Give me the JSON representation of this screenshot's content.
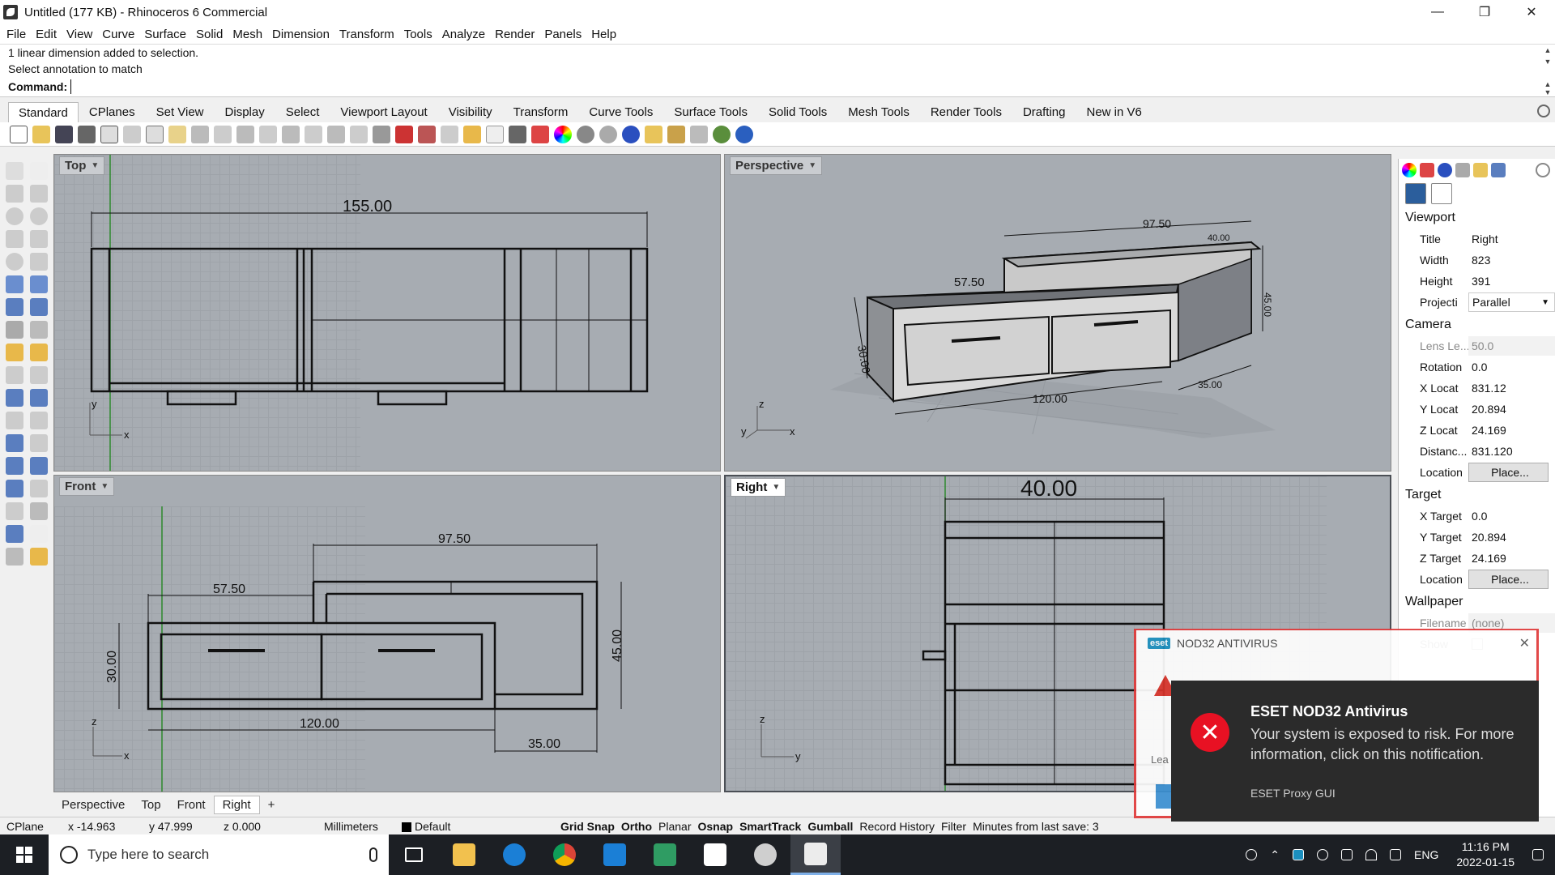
{
  "window": {
    "title": "Untitled (177 KB) - Rhinoceros 6 Commercial",
    "minimize": "—",
    "maximize": "❐",
    "close": "✕"
  },
  "menu": [
    "File",
    "Edit",
    "View",
    "Curve",
    "Surface",
    "Solid",
    "Mesh",
    "Dimension",
    "Transform",
    "Tools",
    "Analyze",
    "Render",
    "Panels",
    "Help"
  ],
  "command": {
    "history": [
      "1 linear dimension added to selection.",
      "Select annotation to match"
    ],
    "prompt": "Command:",
    "value": ""
  },
  "toolbar_tabs": [
    "Standard",
    "CPlanes",
    "Set View",
    "Display",
    "Select",
    "Viewport Layout",
    "Visibility",
    "Transform",
    "Curve Tools",
    "Surface Tools",
    "Solid Tools",
    "Mesh Tools",
    "Render Tools",
    "Drafting",
    "New in V6"
  ],
  "viewports": {
    "top": {
      "label": "Top",
      "dims": {
        "overall": "155.00"
      },
      "axes": {
        "x": "x",
        "y": "y"
      }
    },
    "perspective": {
      "label": "Perspective",
      "dims": {
        "a": "97.50",
        "b": "40.00",
        "c": "57.50",
        "d": "45.00",
        "e": "30.00",
        "f": "120.00",
        "g": "35.00"
      },
      "axes": {
        "x": "x",
        "y": "y",
        "z": "z"
      }
    },
    "front": {
      "label": "Front",
      "dims": {
        "top": "97.50",
        "left": "57.50",
        "height": "45.00",
        "left_height": "30.00",
        "bottom": "120.00",
        "right": "35.00"
      },
      "axes": {
        "x": "x",
        "z": "z"
      }
    },
    "right": {
      "label": "Right",
      "dims": {
        "width": "40.00"
      },
      "axes": {
        "y": "y",
        "z": "z"
      }
    }
  },
  "viewport_tabs": [
    "Perspective",
    "Top",
    "Front",
    "Right",
    "+"
  ],
  "properties": {
    "viewport_heading": "Viewport",
    "title": {
      "key": "Title",
      "value": "Right"
    },
    "width": {
      "key": "Width",
      "value": "823"
    },
    "height": {
      "key": "Height",
      "value": "391"
    },
    "projection": {
      "key": "Projecti",
      "value": "Parallel"
    },
    "camera_heading": "Camera",
    "lens": {
      "key": "Lens Le...",
      "value": "50.0"
    },
    "rotation": {
      "key": "Rotation",
      "value": "0.0"
    },
    "xloc": {
      "key": "X Locat",
      "value": "831.12"
    },
    "yloc": {
      "key": "Y Locat",
      "value": "20.894"
    },
    "zloc": {
      "key": "Z Locat",
      "value": "24.169"
    },
    "distance": {
      "key": "Distanc...",
      "value": "831.120"
    },
    "location": {
      "key": "Location",
      "value": "Place..."
    },
    "target_heading": "Target",
    "xtarget": {
      "key": "X Target",
      "value": "0.0"
    },
    "ytarget": {
      "key": "Y Target",
      "value": "20.894"
    },
    "ztarget": {
      "key": "Z Target",
      "value": "24.169"
    },
    "tlocation": {
      "key": "Location",
      "value": "Place..."
    },
    "wallpaper_heading": "Wallpaper",
    "filename": {
      "key": "Filename",
      "value": "(none)"
    },
    "show": {
      "key": "Show",
      "value": ""
    }
  },
  "status": {
    "cplane": "CPlane",
    "x": "x -14.963",
    "y": "y 47.999",
    "z": "z 0.000",
    "units": "Millimeters",
    "layer": "Default",
    "toggles": [
      "Grid Snap",
      "Ortho",
      "Planar",
      "Osnap",
      "SmartTrack",
      "Gumball",
      "Record History",
      "Filter"
    ],
    "toggles_bold": [
      true,
      true,
      false,
      true,
      true,
      true,
      false,
      false
    ],
    "save": "Minutes from last save: 3"
  },
  "eset_back": {
    "brand": "eset",
    "title": "NOD32 ANTIVIRUS",
    "close": "✕",
    "learn": "Lea"
  },
  "toast": {
    "title": "ESET NOD32 Antivirus",
    "body": "Your system is exposed to risk. For more information, click on this notification.",
    "source": "ESET Proxy GUI",
    "icon": "✕"
  },
  "taskbar": {
    "search_placeholder": "Type here to search",
    "lang": "ENG",
    "time": "11:16 PM",
    "date": "2022-01-15"
  },
  "colors": {
    "viewport_bg": "#a7acb2",
    "accent_eset_red": "#e03a3a",
    "toast_error": "#e81123",
    "taskbar": "#1c1f24"
  }
}
